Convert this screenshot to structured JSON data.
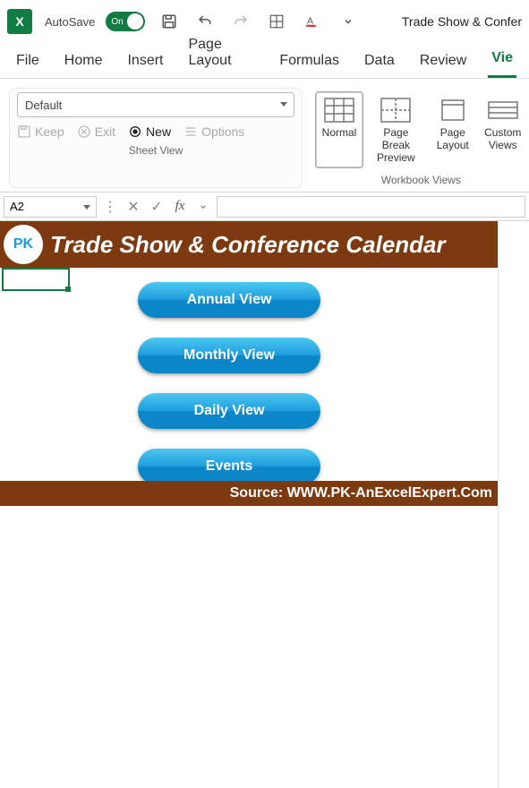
{
  "titlebar": {
    "app_icon_text": "X",
    "autosave_label": "AutoSave",
    "autosave_state": "On",
    "doc_title": "Trade Show & Confer"
  },
  "tabs": {
    "file": "File",
    "home": "Home",
    "insert": "Insert",
    "page_layout": "Page Layout",
    "formulas": "Formulas",
    "data": "Data",
    "review": "Review",
    "view": "Vie"
  },
  "ribbon": {
    "sheet_view": {
      "select_value": "Default",
      "keep": "Keep",
      "exit": "Exit",
      "new": "New",
      "options": "Options",
      "group_label": "Sheet View"
    },
    "workbook_views": {
      "normal": "Normal",
      "page_break": "Page Break\nPreview",
      "page_layout": "Page\nLayout",
      "custom": "Custom\nViews",
      "group_label": "Workbook Views"
    }
  },
  "formula_bar": {
    "namebox": "A2",
    "fx": "fx"
  },
  "sheet": {
    "banner_title": "Trade Show & Conference Calendar",
    "logo_text": "PK",
    "buttons": {
      "annual": "Annual View",
      "monthly": "Monthly View",
      "daily": "Daily View",
      "events": "Events"
    },
    "source": "Source: WWW.PK-AnExcelExpert.Com"
  }
}
